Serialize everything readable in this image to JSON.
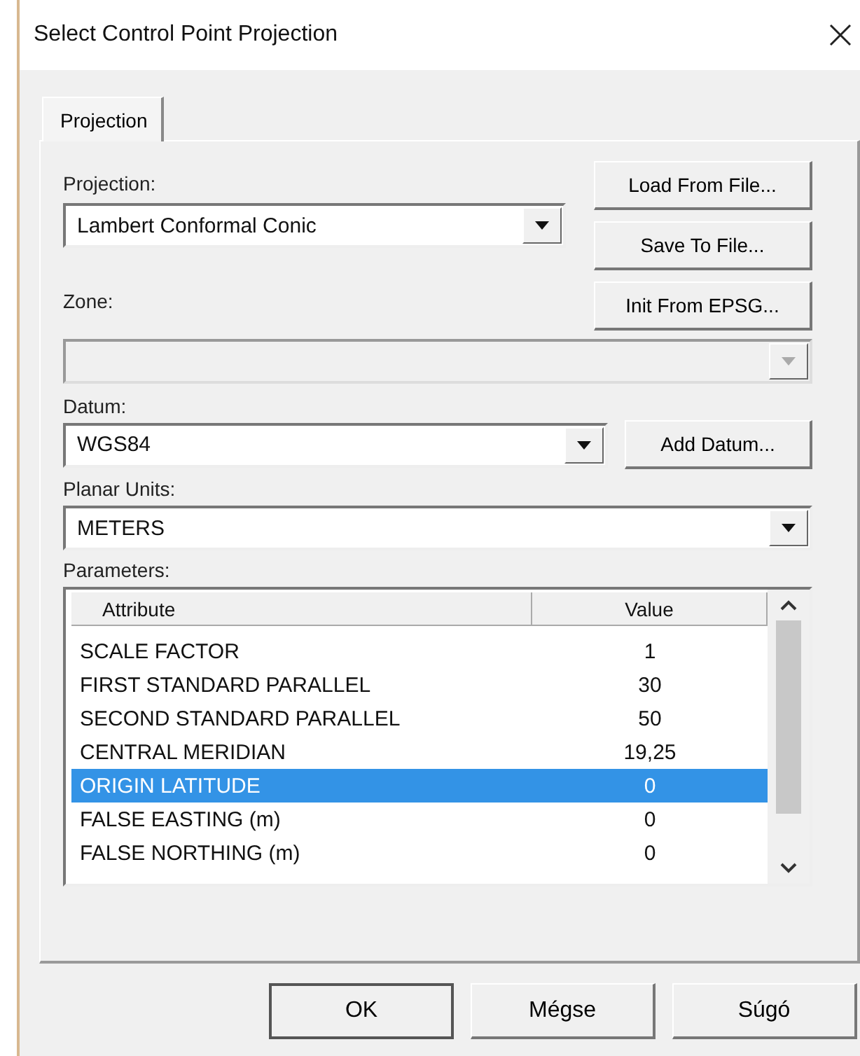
{
  "window": {
    "title": "Select Control Point Projection"
  },
  "tabs": [
    {
      "label": "Projection",
      "selected": true
    }
  ],
  "projection": {
    "label": "Projection:",
    "value": "Lambert Conformal Conic",
    "buttons": [
      "Load From File...",
      "Save To File...",
      "Init From EPSG..."
    ]
  },
  "zone": {
    "label": "Zone:",
    "disabled": true
  },
  "datum": {
    "label": "Datum:",
    "value": "WGS84",
    "button": "Add Datum..."
  },
  "planar_units": {
    "label": "Planar Units:",
    "value": "METERS"
  },
  "parameters": {
    "label": "Parameters:",
    "columns": [
      "Attribute",
      "Value"
    ],
    "rows": [
      {
        "attribute": "SCALE FACTOR",
        "value": "1",
        "selected": false
      },
      {
        "attribute": "FIRST STANDARD PARALLEL",
        "value": "30",
        "selected": false
      },
      {
        "attribute": "SECOND STANDARD PARALLEL",
        "value": "50",
        "selected": false
      },
      {
        "attribute": "CENTRAL MERIDIAN",
        "value": "19,25",
        "selected": false
      },
      {
        "attribute": "ORIGIN LATITUDE",
        "value": "0",
        "selected": true
      },
      {
        "attribute": "FALSE EASTING (m)",
        "value": "0",
        "selected": false
      },
      {
        "attribute": "FALSE NORTHING (m)",
        "value": "0",
        "selected": false
      }
    ]
  },
  "buttons": [
    {
      "label": "OK",
      "default": true
    },
    {
      "label": "Mégse",
      "default": false
    },
    {
      "label": "Súgó",
      "default": false
    }
  ]
}
